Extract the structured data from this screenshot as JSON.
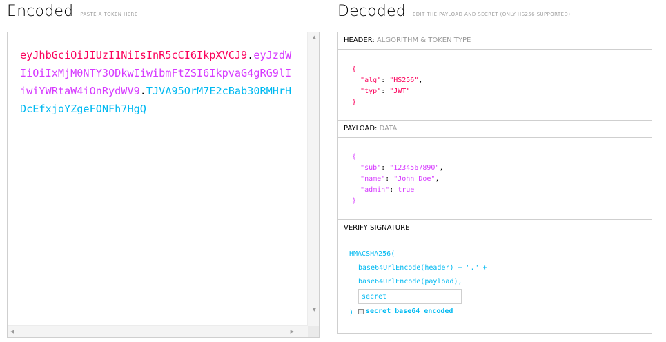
{
  "encoded": {
    "title": "Encoded",
    "hint": "PASTE A TOKEN HERE",
    "token_header": "eyJhbGciOiJIUzI1NiIsInR5cCI6IkpXVCJ9",
    "dot1": ".",
    "token_payload": "eyJzdWIiOiIxMjM0NTY3ODkwIiwibmFtZSI6IkpvaG4gRG9lIiwiYWRtaW4iOnRydWV9",
    "dot2": ".",
    "token_signature": "TJVA95OrM7E2cBab30RMHrHDcEfxjoYZgeFONFh7HgQ"
  },
  "decoded": {
    "title": "Decoded",
    "hint": "EDIT THE PAYLOAD AND SECRET (ONLY HS256 SUPPORTED)",
    "header": {
      "label": "HEADER:",
      "sub": "ALGORITHM & TOKEN TYPE",
      "open": "{",
      "alg_key": "\"alg\"",
      "alg_val": "\"HS256\"",
      "typ_key": "\"typ\"",
      "typ_val": "\"JWT\"",
      "close": "}"
    },
    "payload": {
      "label": "PAYLOAD:",
      "sub": "DATA",
      "open": "{",
      "sub_key": "\"sub\"",
      "sub_val": "\"1234567890\"",
      "name_key": "\"name\"",
      "name_val": "\"John Doe\"",
      "admin_key": "\"admin\"",
      "admin_val": "true",
      "close": "}"
    },
    "signature": {
      "label": "VERIFY SIGNATURE",
      "fn": "HMACSHA256(",
      "line1": "base64UrlEncode(header) + \".\" +",
      "line2": "base64UrlEncode(payload),",
      "secret_value": "secret",
      "close": ")",
      "checkbox_label": "secret base64 encoded"
    }
  },
  "colors": {
    "header": "#fb015b",
    "payload": "#d63aff",
    "signature": "#00b9f1"
  }
}
